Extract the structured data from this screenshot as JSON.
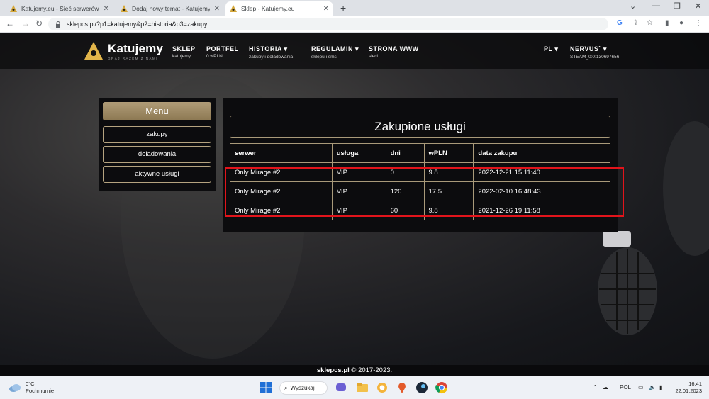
{
  "browser": {
    "tabs": [
      {
        "title": "Katujemy.eu - Sieć serwerów CS",
        "active": false
      },
      {
        "title": "Dodaj nowy temat - Katujemy.eu",
        "active": false
      },
      {
        "title": "Sklep - Katujemy.eu",
        "active": true
      }
    ],
    "new_tab": "+",
    "url": "sklepcs.pl/?p1=katujemy&p2=historia&p3=zakupy",
    "window_controls": {
      "minimize": "—",
      "maximize": "❐",
      "close": "✕"
    }
  },
  "site": {
    "logo": {
      "title": "Katujemy",
      "subtitle": "GRAJ RAZEM Z NAMI"
    },
    "nav": [
      {
        "label": "SKLEP",
        "sub": "katujemy"
      },
      {
        "label": "PORTFEL",
        "sub": "0 wPLN"
      },
      {
        "label": "HISTORIA ▾",
        "sub": "zakupy i doładowania"
      },
      {
        "label": "REGULAMIN ▾",
        "sub": "sklepu i sms"
      },
      {
        "label": "STRONA WWW",
        "sub": "sieci"
      }
    ],
    "lang": {
      "label": "PL ▾"
    },
    "user": {
      "label": "NERVUS` ▾",
      "sub": "STEAM_0:0:130697656"
    },
    "menu": {
      "title": "Menu",
      "items": [
        "zakupy",
        "doładowania",
        "aktywne usługi"
      ]
    },
    "content": {
      "title": "Zakupione usługi",
      "table": {
        "headers": [
          "serwer",
          "usługa",
          "dni",
          "wPLN",
          "data zakupu"
        ],
        "rows": [
          [
            "Only Mirage #2",
            "VIP",
            "0",
            "9.8",
            "2022-12-21 15:11:40"
          ],
          [
            "Only Mirage #2",
            "VIP",
            "120",
            "17.5",
            "2022-02-10 16:48:43"
          ],
          [
            "Only Mirage #2",
            "VIP",
            "60",
            "9.8",
            "2021-12-26 19:11:58"
          ]
        ]
      }
    },
    "footer": {
      "link": "sklepcs.pl",
      "text": " © 2017-2023."
    },
    "colors": {
      "accent": "#b5a37f",
      "highlight": "#e2141b"
    }
  },
  "taskbar": {
    "weather": {
      "temp": "0°C",
      "desc": "Pochmurnie"
    },
    "search": "Wyszukaj",
    "tray": {
      "lang": "POL"
    },
    "clock": {
      "time": "16:41",
      "date": "22.01.2023"
    }
  }
}
